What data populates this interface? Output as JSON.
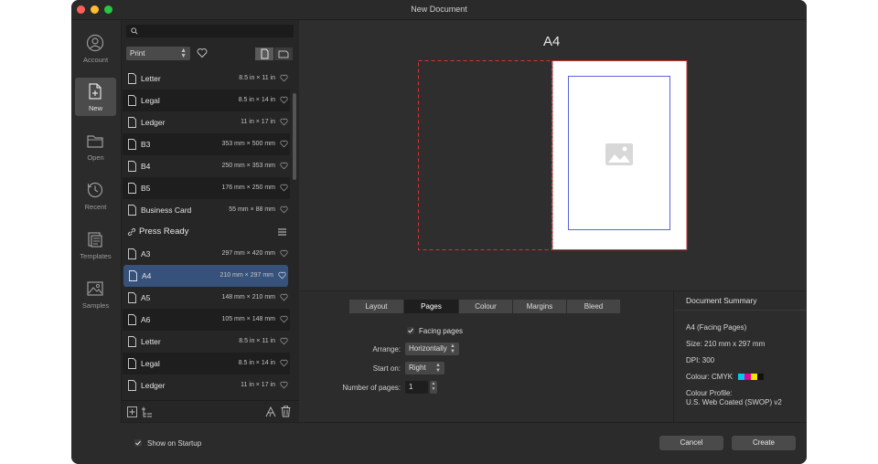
{
  "window": {
    "title": "New Document"
  },
  "nav": [
    {
      "label": "Account",
      "icon": "account-icon"
    },
    {
      "label": "New",
      "icon": "new-document-icon",
      "active": true
    },
    {
      "label": "Open",
      "icon": "folder-icon"
    },
    {
      "label": "Recent",
      "icon": "recent-clock-icon"
    },
    {
      "label": "Templates",
      "icon": "templates-icon"
    },
    {
      "label": "Samples",
      "icon": "samples-image-icon"
    }
  ],
  "search": {
    "placeholder": ""
  },
  "category": {
    "selected": "Print"
  },
  "print_items": [
    {
      "name": "Letter",
      "size": "8.5 in × 11 in"
    },
    {
      "name": "Legal",
      "size": "8.5 in × 14 in"
    },
    {
      "name": "Ledger",
      "size": "11 in × 17 in"
    },
    {
      "name": "B3",
      "size": "353 mm × 500 mm"
    },
    {
      "name": "B4",
      "size": "250 mm × 353 mm"
    },
    {
      "name": "B5",
      "size": "176 mm × 250 mm"
    },
    {
      "name": "Business Card",
      "size": "55 mm × 88 mm"
    }
  ],
  "section": {
    "title": "Press Ready"
  },
  "press_items": [
    {
      "name": "A3",
      "size": "297 mm × 420 mm"
    },
    {
      "name": "A4",
      "size": "210 mm × 297 mm",
      "selected": true
    },
    {
      "name": "A5",
      "size": "148 mm × 210 mm"
    },
    {
      "name": "A6",
      "size": "105 mm × 148 mm"
    },
    {
      "name": "Letter",
      "size": "8.5 in × 11 in"
    },
    {
      "name": "Legal",
      "size": "8.5 in × 14 in"
    },
    {
      "name": "Ledger",
      "size": "11 in × 17 in"
    }
  ],
  "preview": {
    "title": "A4"
  },
  "tabs": [
    "Layout",
    "Pages",
    "Colour",
    "Margins",
    "Bleed"
  ],
  "active_tab": "Pages",
  "pages": {
    "facing_label": "Facing pages",
    "facing_checked": true,
    "arrange_label": "Arrange:",
    "arrange_value": "Horizontally",
    "start_label": "Start on:",
    "start_value": "Right",
    "num_label": "Number of pages:",
    "num_value": "1"
  },
  "summary": {
    "heading": "Document Summary",
    "doc": "A4 (Facing Pages)",
    "size": "Size: 210 mm x 297 mm",
    "dpi": "DPI:  300",
    "colour": "Colour: CMYK",
    "profile_label": "Colour Profile:",
    "profile_value": "U.S. Web Coated (SWOP) v2",
    "swatches": [
      "#00c8f0",
      "#e8009a",
      "#f5e400",
      "#111111"
    ]
  },
  "footer": {
    "show_startup": "Show on Startup",
    "show_startup_checked": true,
    "cancel": "Cancel",
    "create": "Create"
  },
  "colors": {
    "accent_selection": "#37527a",
    "bleed_red": "#e03030",
    "margin_blue": "#5c63d8"
  }
}
